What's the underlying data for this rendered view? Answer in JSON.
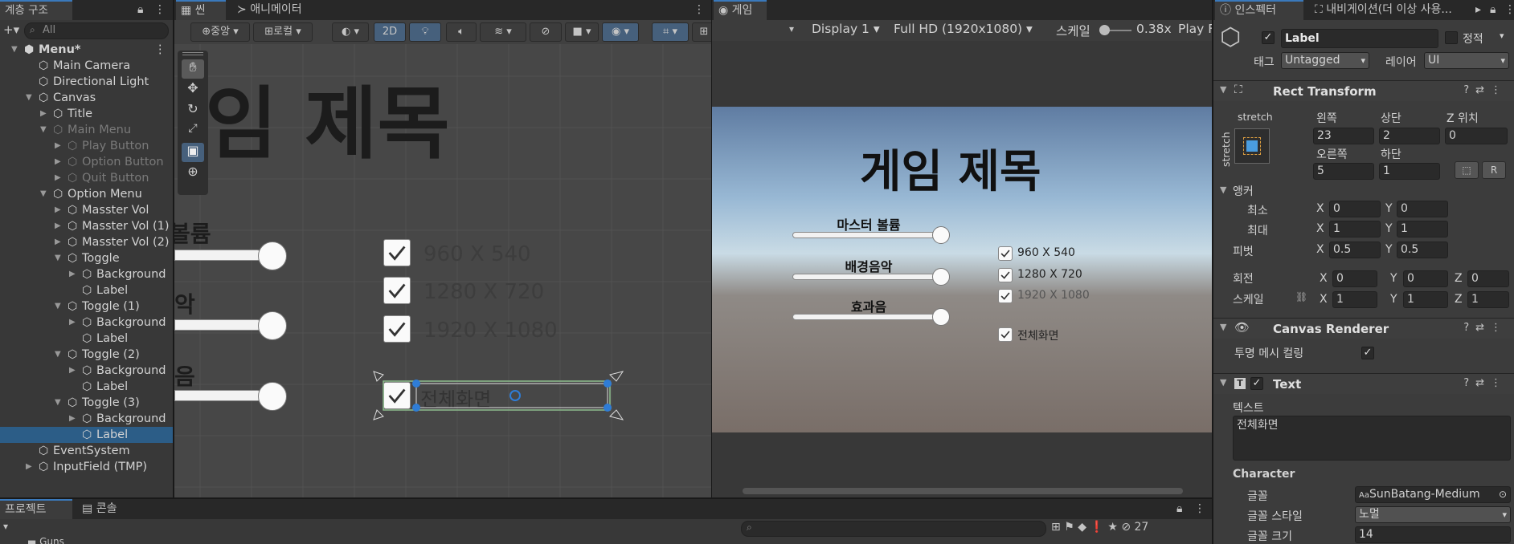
{
  "hierarchy": {
    "tab_label": "계층 구조",
    "search_placeholder": "All",
    "items": [
      {
        "label": "Menu*",
        "depth": 0,
        "dim": false
      },
      {
        "label": "Main Camera",
        "depth": 1,
        "dim": false
      },
      {
        "label": "Directional Light",
        "depth": 1,
        "dim": false
      },
      {
        "label": "Canvas",
        "depth": 1,
        "dim": false
      },
      {
        "label": "Title",
        "depth": 2,
        "dim": false
      },
      {
        "label": "Main Menu",
        "depth": 2,
        "dim": true
      },
      {
        "label": "Play Button",
        "depth": 3,
        "dim": true
      },
      {
        "label": "Option Button",
        "depth": 3,
        "dim": true
      },
      {
        "label": "Quit Button",
        "depth": 3,
        "dim": true
      },
      {
        "label": "Option Menu",
        "depth": 2,
        "dim": false
      },
      {
        "label": "Masster Vol",
        "depth": 3,
        "dim": false
      },
      {
        "label": "Masster Vol (1)",
        "depth": 3,
        "dim": false
      },
      {
        "label": "Masster Vol (2)",
        "depth": 3,
        "dim": false
      },
      {
        "label": "Toggle",
        "depth": 3,
        "dim": false
      },
      {
        "label": "Background",
        "depth": 4,
        "dim": false
      },
      {
        "label": "Label",
        "depth": 4,
        "dim": false
      },
      {
        "label": "Toggle (1)",
        "depth": 3,
        "dim": false
      },
      {
        "label": "Background",
        "depth": 4,
        "dim": false
      },
      {
        "label": "Label",
        "depth": 4,
        "dim": false
      },
      {
        "label": "Toggle (2)",
        "depth": 3,
        "dim": false
      },
      {
        "label": "Background",
        "depth": 4,
        "dim": false
      },
      {
        "label": "Label",
        "depth": 4,
        "dim": false
      },
      {
        "label": "Toggle (3)",
        "depth": 3,
        "dim": false
      },
      {
        "label": "Background",
        "depth": 4,
        "dim": false
      },
      {
        "label": "Label",
        "depth": 4,
        "dim": false,
        "selected": true
      },
      {
        "label": "EventSystem",
        "depth": 1,
        "dim": false
      },
      {
        "label": "InputField (TMP)",
        "depth": 1,
        "dim": false
      }
    ]
  },
  "scene": {
    "tab_scene": "씬",
    "tab_animator": "애니메이터",
    "toolbar": {
      "pivot": "중앙",
      "space": "로컬",
      "mode_2d": "2D"
    },
    "title_text": "임 제목",
    "slider_labels": [
      "볼륨",
      "악",
      "음"
    ],
    "toggle_labels": [
      "960 X 540",
      "1280 X 720",
      "1920 X 1080",
      "전체화면"
    ]
  },
  "game": {
    "tab_label": "게임",
    "display": "Display 1",
    "resolution": "Full HD (1920x1080)",
    "scale_label": "스케일",
    "scale_value": "0.38x",
    "play_label": "Play F",
    "title_text": "게임 제목",
    "sliders": [
      {
        "label": "마스터 볼륨",
        "value": 1.0
      },
      {
        "label": "배경음악",
        "value": 1.0
      },
      {
        "label": "효과음",
        "value": 1.0
      }
    ],
    "toggles": [
      {
        "label": "960 X 540",
        "checked": true
      },
      {
        "label": "1280 X 720",
        "checked": true
      },
      {
        "label": "1920 X 1080",
        "checked": true
      },
      {
        "label": "전체화면",
        "checked": true
      }
    ]
  },
  "inspector": {
    "tab_inspector": "인스펙터",
    "tab_navigation": "내비게이션(더 이상 사용...",
    "object_name": "Label",
    "static_label": "정적",
    "tag_label": "태그",
    "tag_value": "Untagged",
    "layer_label": "레이어",
    "layer_value": "UI",
    "rect_transform": {
      "header": "Rect Transform",
      "anchor_preset_h": "stretch",
      "anchor_preset_v": "stretch",
      "left_label": "왼쪽",
      "left": "23",
      "top_label": "상단",
      "top": "2",
      "posz_label": "Z 위치",
      "posz": "0",
      "right_label": "오른쪽",
      "right": "5",
      "bottom_label": "하단",
      "bottom": "1",
      "anchors_label": "앵커",
      "min_label": "최소",
      "min_x": "0",
      "min_y": "0",
      "max_label": "최대",
      "max_x": "1",
      "max_y": "1",
      "pivot_label": "피벗",
      "pivot_x": "0.5",
      "pivot_y": "0.5",
      "rotation_label": "회전",
      "rot_x": "0",
      "rot_y": "0",
      "rot_z": "0",
      "scale_label": "스케일",
      "scale_x": "1",
      "scale_y": "1",
      "scale_z": "1",
      "x": "X",
      "y": "Y",
      "z": "Z",
      "edit_r": "R"
    },
    "canvas_renderer": {
      "header": "Canvas Renderer",
      "cull_label": "투명 메시 컬링"
    },
    "text": {
      "header": "Text",
      "text_label": "텍스트",
      "text_value": "전체화면",
      "character_label": "Character",
      "font_label": "글꼴",
      "font_value": "SunBatang-Medium",
      "font_style_label": "글꼴 스타일",
      "font_style_value": "노멀",
      "font_size_label": "글꼴 크기",
      "font_size_value": "14"
    }
  },
  "bottom": {
    "tab_project": "프로젝트",
    "tab_console": "콘솔",
    "hidden_count": "27",
    "folder_label": "Guns"
  },
  "colors": {
    "selection": "#2c5d87",
    "accent_tab": "#3a79bb",
    "panel_bg": "#383838"
  }
}
